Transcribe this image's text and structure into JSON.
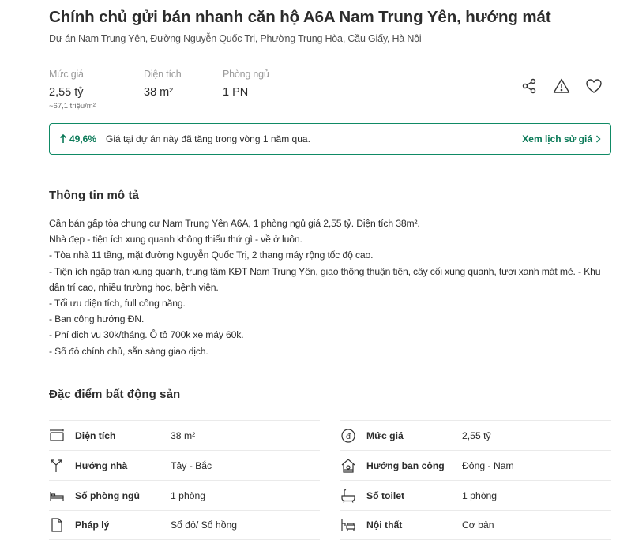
{
  "listing": {
    "title": "Chính chủ gửi bán nhanh căn hộ A6A Nam Trung Yên, hướng mát",
    "address": "Dự án Nam Trung Yên, Đường Nguyễn Quốc Trị, Phường Trung Hòa, Cầu Giấy, Hà Nội"
  },
  "stats": {
    "price": {
      "label": "Mức giá",
      "value": "2,55 tỷ",
      "sub": "~67,1 triệu/m²"
    },
    "area": {
      "label": "Diện tích",
      "value": "38 m²"
    },
    "bedrooms": {
      "label": "Phòng ngủ",
      "value": "1 PN"
    }
  },
  "actions": {
    "share_icon": "share-icon",
    "report_icon": "warning-icon",
    "save_icon": "heart-icon"
  },
  "trend": {
    "percent": "49,6%",
    "message": "Giá tại dự án này đã tăng trong vòng 1 năm qua.",
    "link": "Xem lịch sử giá"
  },
  "description": {
    "heading": "Thông tin mô tả",
    "lines": [
      "Cần bán gấp tòa chung cư Nam Trung Yên A6A, 1 phòng ngủ giá 2,55 tỷ. Diện tích 38m².",
      "Nhà đẹp - tiện ích xung quanh không thiếu thứ gì - về ở luôn.",
      "- Tòa nhà 11 tầng, mặt đường Nguyễn Quốc Trị, 2 thang máy rộng tốc độ cao.",
      "- Tiện ích ngập tràn xung quanh, trung tâm KĐT Nam Trung Yên, giao thông thuận tiện, cây cối xung quanh, tươi xanh mát mẻ. - Khu dân trí cao, nhiều trường học, bệnh viện.",
      "- Tối ưu diện tích, full công năng.",
      "- Ban công hướng ĐN.",
      "- Phí dịch vụ 30k/tháng. Ô tô 700k xe máy 60k.",
      "- Sổ đỏ chính chủ, sẵn sàng giao dịch."
    ]
  },
  "features": {
    "heading": "Đặc điểm bất động sản",
    "left": [
      {
        "icon": "area-icon",
        "key": "Diện tích",
        "value": "38 m²"
      },
      {
        "icon": "direction-icon",
        "key": "Hướng nhà",
        "value": "Tây - Bắc"
      },
      {
        "icon": "bed-icon",
        "key": "Số phòng ngủ",
        "value": "1 phòng"
      },
      {
        "icon": "document-icon",
        "key": "Pháp lý",
        "value": "Sổ đỏ/ Sổ hồng"
      }
    ],
    "right": [
      {
        "icon": "price-icon",
        "key": "Mức giá",
        "value": "2,55 tỷ"
      },
      {
        "icon": "balcony-icon",
        "key": "Hướng ban công",
        "value": "Đông - Nam"
      },
      {
        "icon": "bathtub-icon",
        "key": "Số toilet",
        "value": "1 phòng"
      },
      {
        "icon": "furniture-icon",
        "key": "Nội thất",
        "value": "Cơ bản"
      }
    ]
  },
  "colors": {
    "accent": "#0b7a58",
    "border_accent": "#0f8a65",
    "text": "#2c2c2c",
    "muted": "#999999"
  }
}
